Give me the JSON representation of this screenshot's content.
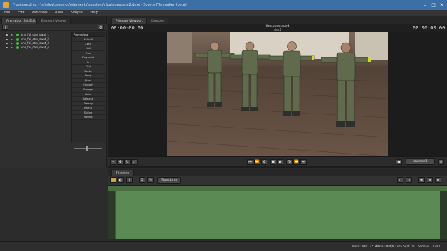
{
  "window": {
    "title": "Frontage.dmx - \\sfmlev\\usermod\\elements\\sessions\\Hostagestage2.dmx - Source Filmmaker (beta)",
    "colors": {
      "titlebar": "#3b6fa5",
      "accent_green": "#5c8a55",
      "selection_dot": "#3bbf3b"
    }
  },
  "menu": [
    "File",
    "Edit",
    "Windows",
    "View",
    "Simple",
    "Help"
  ],
  "left_panel": {
    "tabs": [
      "Animation Set Editor",
      "Element Viewer"
    ],
    "add_label": "+",
    "tree": [
      "cnn_fbi_ctm_swat_1",
      "cnn_fbi_ctm_swat_2",
      "cnn_fbi_ctm_swat_3",
      "cnn_fbi_ctm_swat_4"
    ],
    "procedural_header": "Procedural",
    "procedural": [
      "Default",
      "Zero",
      "Half",
      "One",
      "Playhead",
      "In",
      "Out",
      "Paste",
      "Drop",
      "Jitter",
      "Smooth",
      "Stagger",
      "Hold",
      "Release",
      "Steady",
      "Ramp",
      "Spline",
      "Round"
    ]
  },
  "viewport": {
    "tabs": [
      "Primary Viewport",
      "Console"
    ],
    "timecode_left": "00:00:00.00",
    "timecode_right": "00:00:00.00",
    "shot_title": "Hostagestage3",
    "shot_sub": "shot1",
    "controls": [
      "⏮",
      "⏪",
      "❮",
      "■",
      "▶",
      "❯",
      "⏩",
      "⏭"
    ],
    "camera": "camera1"
  },
  "timeline": {
    "tab": "Timeline",
    "transform_label": "Transform"
  },
  "status": {
    "memory": "Mem: 1981.45 MB",
    "game": "Game: 461.5",
    "fps": "fps: 305.5/24.00",
    "mode": "Sample",
    "page": "1 of 1"
  }
}
